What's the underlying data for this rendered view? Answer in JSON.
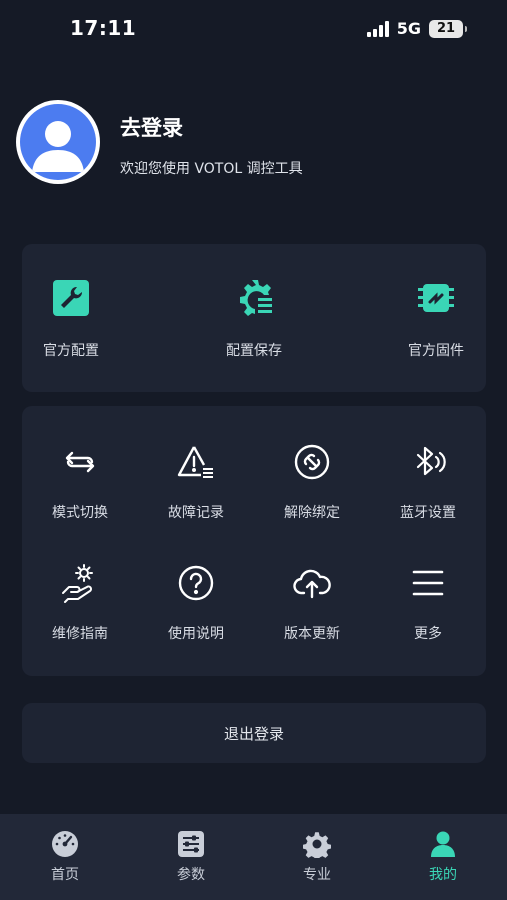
{
  "status_bar": {
    "time": "17:11",
    "network": "5G",
    "battery": "21"
  },
  "profile": {
    "title": "去登录",
    "subtitle": "欢迎您使用 VOTOL 调控工具"
  },
  "quick_actions": [
    {
      "label": "官方配置",
      "icon": "wrench-icon"
    },
    {
      "label": "配置保存",
      "icon": "gear-save-icon"
    },
    {
      "label": "官方固件",
      "icon": "chip-icon"
    }
  ],
  "tools": [
    {
      "label": "模式切换",
      "icon": "swap-icon"
    },
    {
      "label": "故障记录",
      "icon": "warning-list-icon"
    },
    {
      "label": "解除绑定",
      "icon": "unlink-icon"
    },
    {
      "label": "蓝牙设置",
      "icon": "bluetooth-icon"
    },
    {
      "label": "维修指南",
      "icon": "hand-gear-icon"
    },
    {
      "label": "使用说明",
      "icon": "help-icon"
    },
    {
      "label": "版本更新",
      "icon": "cloud-upload-icon"
    },
    {
      "label": "更多",
      "icon": "menu-icon"
    }
  ],
  "logout": {
    "label": "退出登录"
  },
  "tabbar": [
    {
      "label": "首页",
      "icon": "gauge-icon",
      "active": false
    },
    {
      "label": "参数",
      "icon": "sliders-icon",
      "active": false
    },
    {
      "label": "专业",
      "icon": "gear-icon",
      "active": false
    },
    {
      "label": "我的",
      "icon": "person-icon",
      "active": true
    }
  ],
  "colors": {
    "accent": "#3ad6b6",
    "background": "#151a26",
    "card": "#1e2433",
    "tabbar": "#222838",
    "avatar": "#4c7cf0"
  }
}
